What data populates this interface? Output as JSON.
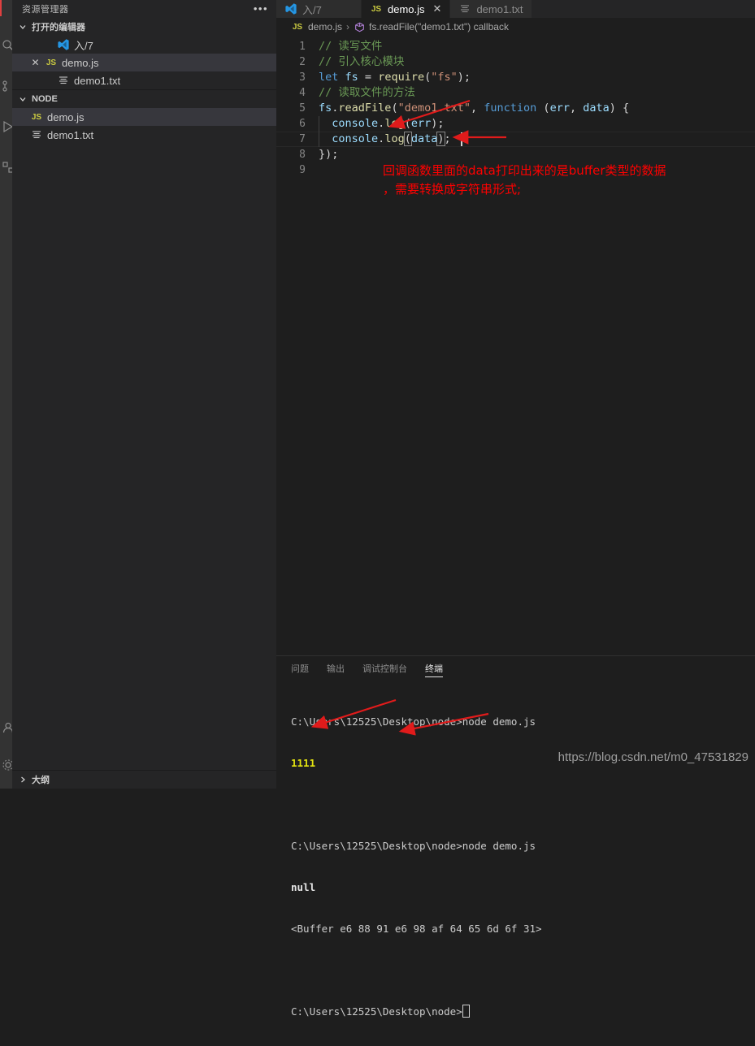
{
  "activity_bar": {
    "icons": [
      "explorer-icon",
      "search-icon",
      "source-control-icon",
      "run-debug-icon",
      "extensions-icon",
      "account-icon",
      "settings-gear-icon"
    ]
  },
  "sidebar": {
    "title": "资源管理器",
    "more_actions": "•••",
    "open_editors": {
      "label": "打开的编辑器",
      "items": [
        {
          "name": "入/7",
          "icon": "vscode-logo-icon",
          "selected": false,
          "closable": false,
          "indent": 40
        },
        {
          "name": "demo.js",
          "icon": "js-file-icon",
          "selected": true,
          "closable": true,
          "indent": 18
        },
        {
          "name": "demo1.txt",
          "icon": "text-file-icon",
          "selected": false,
          "closable": false,
          "indent": 40
        }
      ]
    },
    "folder": {
      "label": "NODE",
      "items": [
        {
          "name": "demo.js",
          "icon": "js-file-icon",
          "selected": true
        },
        {
          "name": "demo1.txt",
          "icon": "text-file-icon",
          "selected": false
        }
      ]
    },
    "outline": {
      "label": "大纲"
    }
  },
  "tabs": [
    {
      "label": "入/7",
      "icon": "vscode-logo-icon",
      "active": false,
      "closable": false
    },
    {
      "label": "demo.js",
      "icon": "js-file-icon",
      "active": true,
      "closable": true,
      "close_glyph": "✕"
    },
    {
      "label": "demo1.txt",
      "icon": "text-file-icon",
      "active": false,
      "closable": false
    }
  ],
  "breadcrumb": {
    "file": "demo.js",
    "separator": "›",
    "symbol": "fs.readFile(\"demo1.txt\") callback"
  },
  "editor": {
    "line_numbers": [
      "1",
      "2",
      "3",
      "4",
      "5",
      "6",
      "7",
      "8",
      "9"
    ],
    "lines": [
      "// 读写文件",
      "// 引入核心模块",
      "let fs = require(\"fs\");",
      "// 读取文件的方法",
      "fs.readFile(\"demo1.txt\", function (err, data) {",
      "  console.log(err);",
      "  console.log(data);",
      "});",
      ""
    ],
    "annotation_line1": "回调函数里面的data打印出来的是buffer类型的数据",
    "annotation_line2": "，需要转换成字符串形式;",
    "annotation_color": "#ff0000"
  },
  "panel": {
    "tabs": [
      {
        "label": "问题",
        "active": false
      },
      {
        "label": "输出",
        "active": false
      },
      {
        "label": "调试控制台",
        "active": false
      },
      {
        "label": "终端",
        "active": true
      }
    ],
    "terminal_lines": [
      {
        "text": "C:\\Users\\12525\\Desktop\\node>node demo.js",
        "style": "normal"
      },
      {
        "text": "1111",
        "style": "yellow"
      },
      {
        "text": "",
        "style": "normal"
      },
      {
        "text": "C:\\Users\\12525\\Desktop\\node>node demo.js",
        "style": "normal"
      },
      {
        "text": "null",
        "style": "bold"
      },
      {
        "text": "<Buffer e6 88 91 e6 98 af 64 65 6d 6f 31>",
        "style": "normal"
      },
      {
        "text": "",
        "style": "normal"
      },
      {
        "text": "C:\\Users\\12525\\Desktop\\node>",
        "style": "prompt"
      }
    ]
  },
  "watermark": "https://blog.csdn.net/m0_47531829"
}
